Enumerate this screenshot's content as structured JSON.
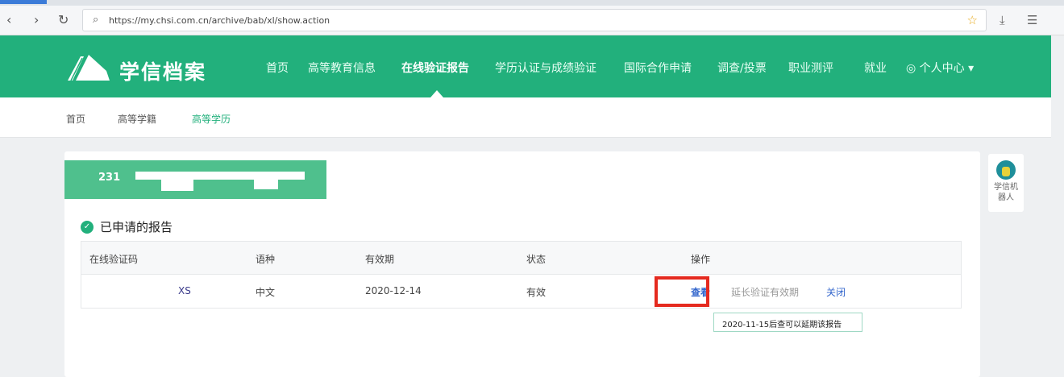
{
  "browser": {
    "url": "https://my.chsi.com.cn/archive/bab/xl/show.action"
  },
  "header": {
    "brand": "学信档案",
    "nav": [
      "首页",
      "高等教育信息",
      "在线验证报告",
      "学历认证与成绩验证",
      "国际合作申请",
      "调查/投票",
      "职业测评",
      "就业",
      "个人中心"
    ]
  },
  "subnav": [
    "首页",
    "高等学籍",
    "高等学历"
  ],
  "banner": {
    "prefix": "231"
  },
  "section": {
    "title": "已申请的报告"
  },
  "table": {
    "headers": [
      "在线验证码",
      "语种",
      "有效期",
      "状态",
      "操作"
    ],
    "rows": [
      {
        "code": "XS",
        "language": "中文",
        "expiry": "2020-12-14",
        "status": "有效",
        "actions": [
          "查看",
          "延长验证有效期",
          "关闭"
        ]
      }
    ]
  },
  "tooltip": "2020-11-15后查可以延期该报告",
  "robot": {
    "label": "学信机器人"
  },
  "colors": {
    "brand": "#22b07c",
    "highlight": "#e52a1f",
    "link": "#3366cc"
  }
}
